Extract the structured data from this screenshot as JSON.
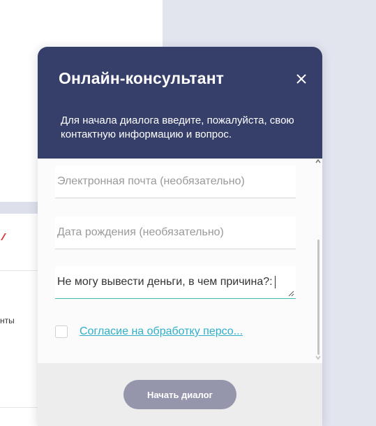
{
  "background_page": {
    "partial_text": "нты"
  },
  "widget": {
    "title": "Онлайн-консультант",
    "subtitle": "Для начала диалога введите, пожалуйста, свою контактную информацию и вопрос.",
    "close_icon": "close-icon",
    "fields": {
      "email_placeholder": "Электронная почта (необязательно)",
      "dob_placeholder": "Дата рождения (необязательно)",
      "message_value": "Не могу вывести деньги, в чем причина?:"
    },
    "consent": {
      "checked": false,
      "link_label": "Согласие на обработку персо..."
    },
    "start_button_label": "Начать диалог",
    "colors": {
      "header": "#363e6a",
      "accent_link": "#2fb0c8",
      "button": "#9596ac",
      "focus_underline": "#3fb9b2"
    }
  }
}
